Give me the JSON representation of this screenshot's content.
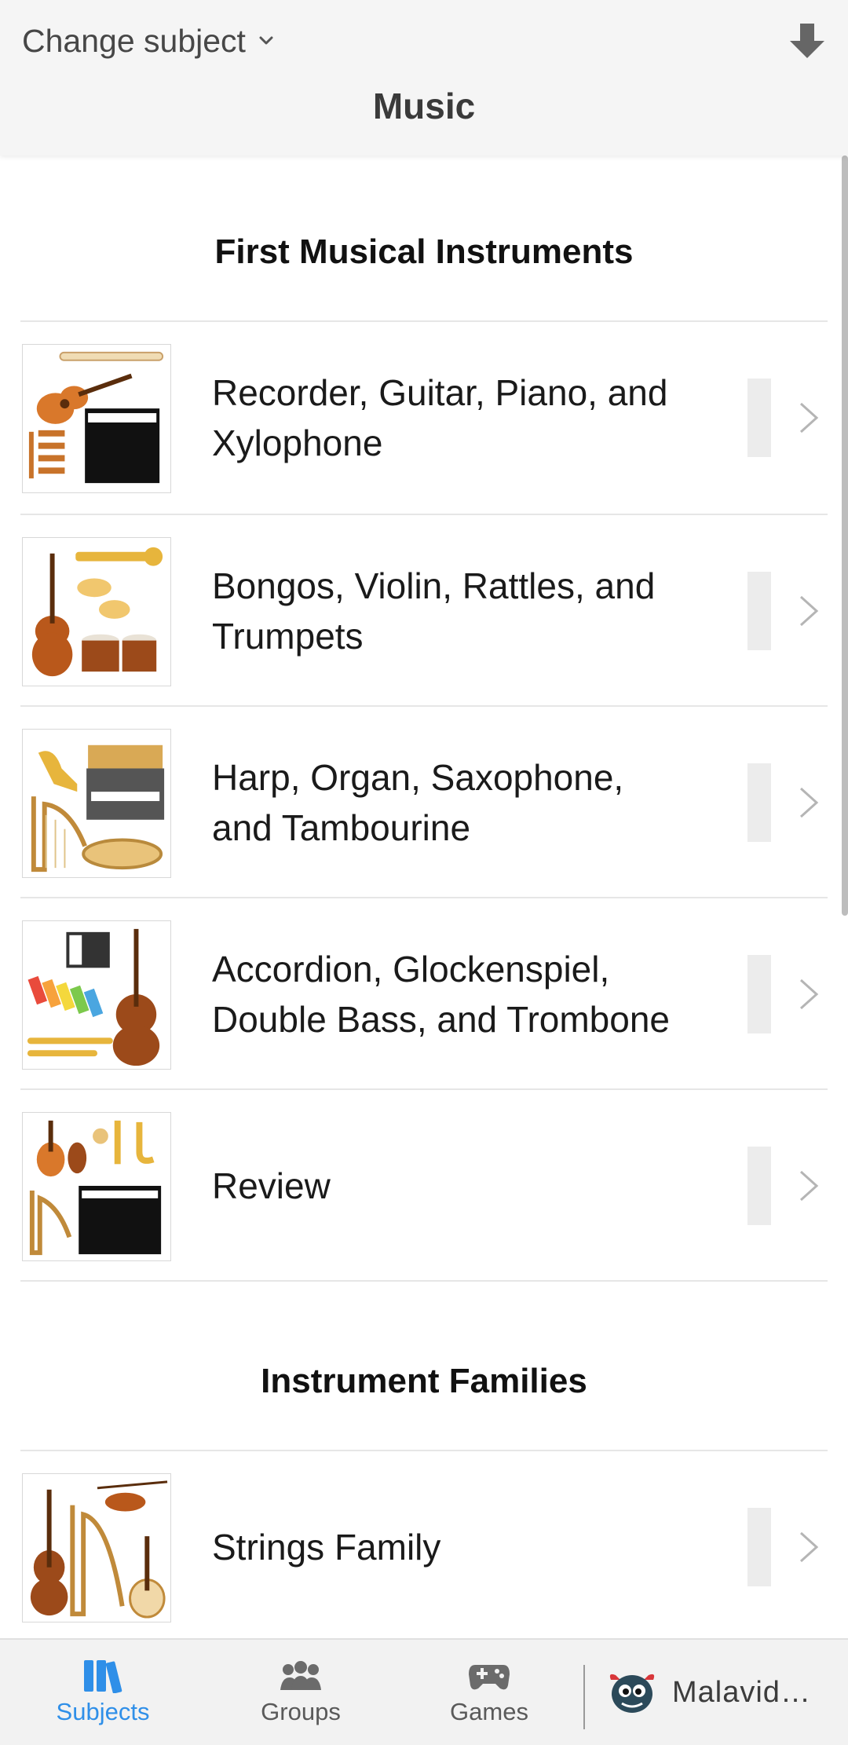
{
  "header": {
    "change_subject_label": "Change subject",
    "title": "Music"
  },
  "sections": [
    {
      "title": "First Musical Instruments",
      "items": [
        {
          "label": "Recorder, Guitar, Piano, and Xylophone"
        },
        {
          "label": "Bongos, Violin, Rattles, and Trumpets"
        },
        {
          "label": "Harp, Organ, Saxophone, and Tambourine"
        },
        {
          "label": "Accordion, Glockenspiel, Double Bass, and Trombone"
        },
        {
          "label": "Review"
        }
      ]
    },
    {
      "title": "Instrument Families",
      "items": [
        {
          "label": "Strings Family"
        }
      ]
    }
  ],
  "nav": {
    "subjects": "Subjects",
    "groups": "Groups",
    "games": "Games",
    "profile_name": "Malavid…"
  },
  "colors": {
    "accent": "#2f8fe8",
    "header_bg": "#f5f5f5",
    "nav_bg": "#f2f2f2",
    "wood": "#c8732a",
    "brass": "#e7b53c"
  },
  "icons": {
    "change_subject": "chevron-down-icon",
    "download": "download-arrow-icon",
    "row_chevron": "chevron-right-icon",
    "subjects": "books-icon",
    "groups": "people-icon",
    "games": "gamepad-icon",
    "profile": "monster-avatar-icon"
  }
}
